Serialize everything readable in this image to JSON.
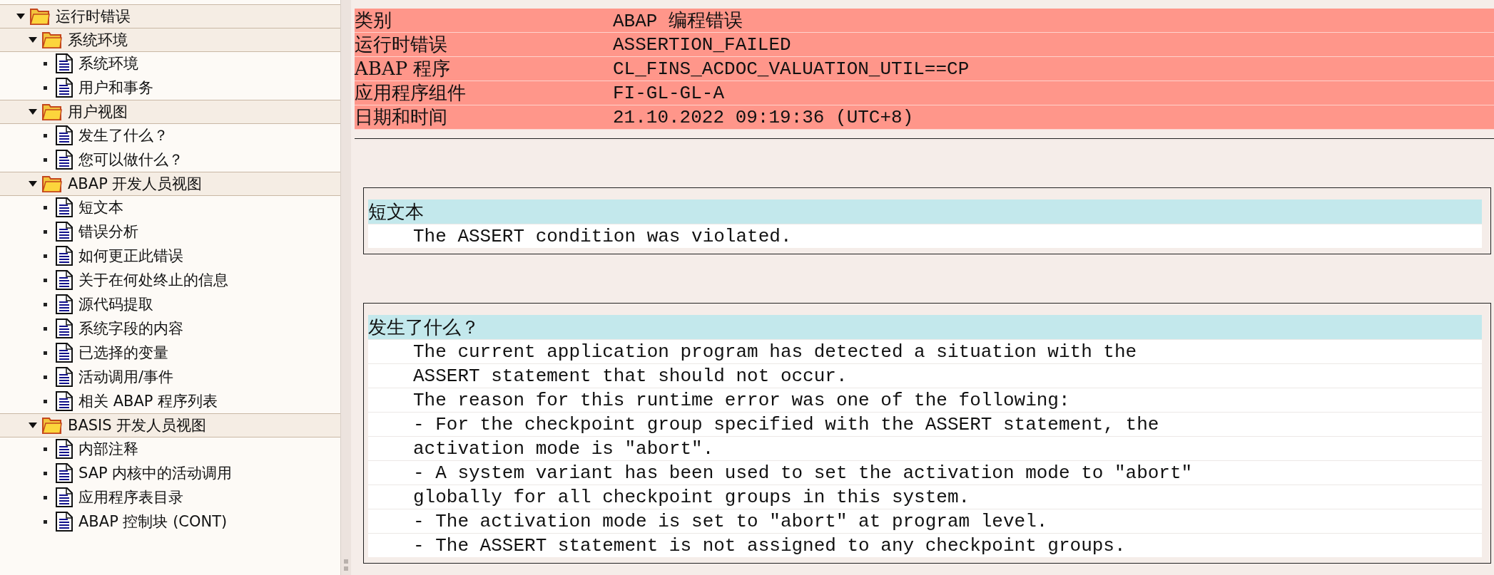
{
  "tree": [
    {
      "label": "运行时错误",
      "expanded": true,
      "children": [
        {
          "label": "系统环境",
          "expanded": true,
          "children": [
            {
              "label": "系统环境"
            },
            {
              "label": "用户和事务"
            }
          ]
        },
        {
          "label": "用户视图",
          "expanded": true,
          "children": [
            {
              "label": "发生了什么？"
            },
            {
              "label": "您可以做什么？"
            }
          ]
        },
        {
          "label": "ABAP 开发人员视图",
          "expanded": true,
          "children": [
            {
              "label": "短文本"
            },
            {
              "label": "错误分析"
            },
            {
              "label": "如何更正此错误"
            },
            {
              "label": "关于在何处终止的信息"
            },
            {
              "label": "源代码提取"
            },
            {
              "label": "系统字段的内容"
            },
            {
              "label": "已选择的变量"
            },
            {
              "label": "活动调用/事件"
            },
            {
              "label": "相关 ABAP 程序列表"
            }
          ]
        },
        {
          "label": "BASIS 开发人员视图",
          "expanded": true,
          "children": [
            {
              "label": "内部注释"
            },
            {
              "label": "SAP 内核中的活动调用"
            },
            {
              "label": "应用程序表目录"
            },
            {
              "label": "ABAP 控制块 (CONT)"
            }
          ]
        }
      ]
    }
  ],
  "header": [
    {
      "label": "类别",
      "value": "ABAP 编程错误"
    },
    {
      "label": "运行时错误",
      "value": "ASSERTION_FAILED"
    },
    {
      "label": "ABAP 程序",
      "value": "CL_FINS_ACDOC_VALUATION_UTIL==CP"
    },
    {
      "label": "应用程序组件",
      "value": "FI-GL-GL-A"
    },
    {
      "label": "日期和时间",
      "value": "21.10.2022 09:19:36 (UTC+8)"
    }
  ],
  "sections": [
    {
      "title": "短文本",
      "lines": [
        "The ASSERT condition was violated."
      ]
    },
    {
      "title": "发生了什么？",
      "lines": [
        "The current application program has detected a situation with the",
        "ASSERT statement that should not occur.",
        "The reason for this runtime error was one of the following:",
        "- For the checkpoint group specified with the ASSERT statement, the",
        "activation mode is \"abort\".",
        "- A system variant has been used to set the activation mode to \"abort\"",
        "globally for all checkpoint groups in this system.",
        "- The activation mode is set to \"abort\" at program level.",
        "- The ASSERT statement is not assigned to any checkpoint groups."
      ]
    }
  ]
}
